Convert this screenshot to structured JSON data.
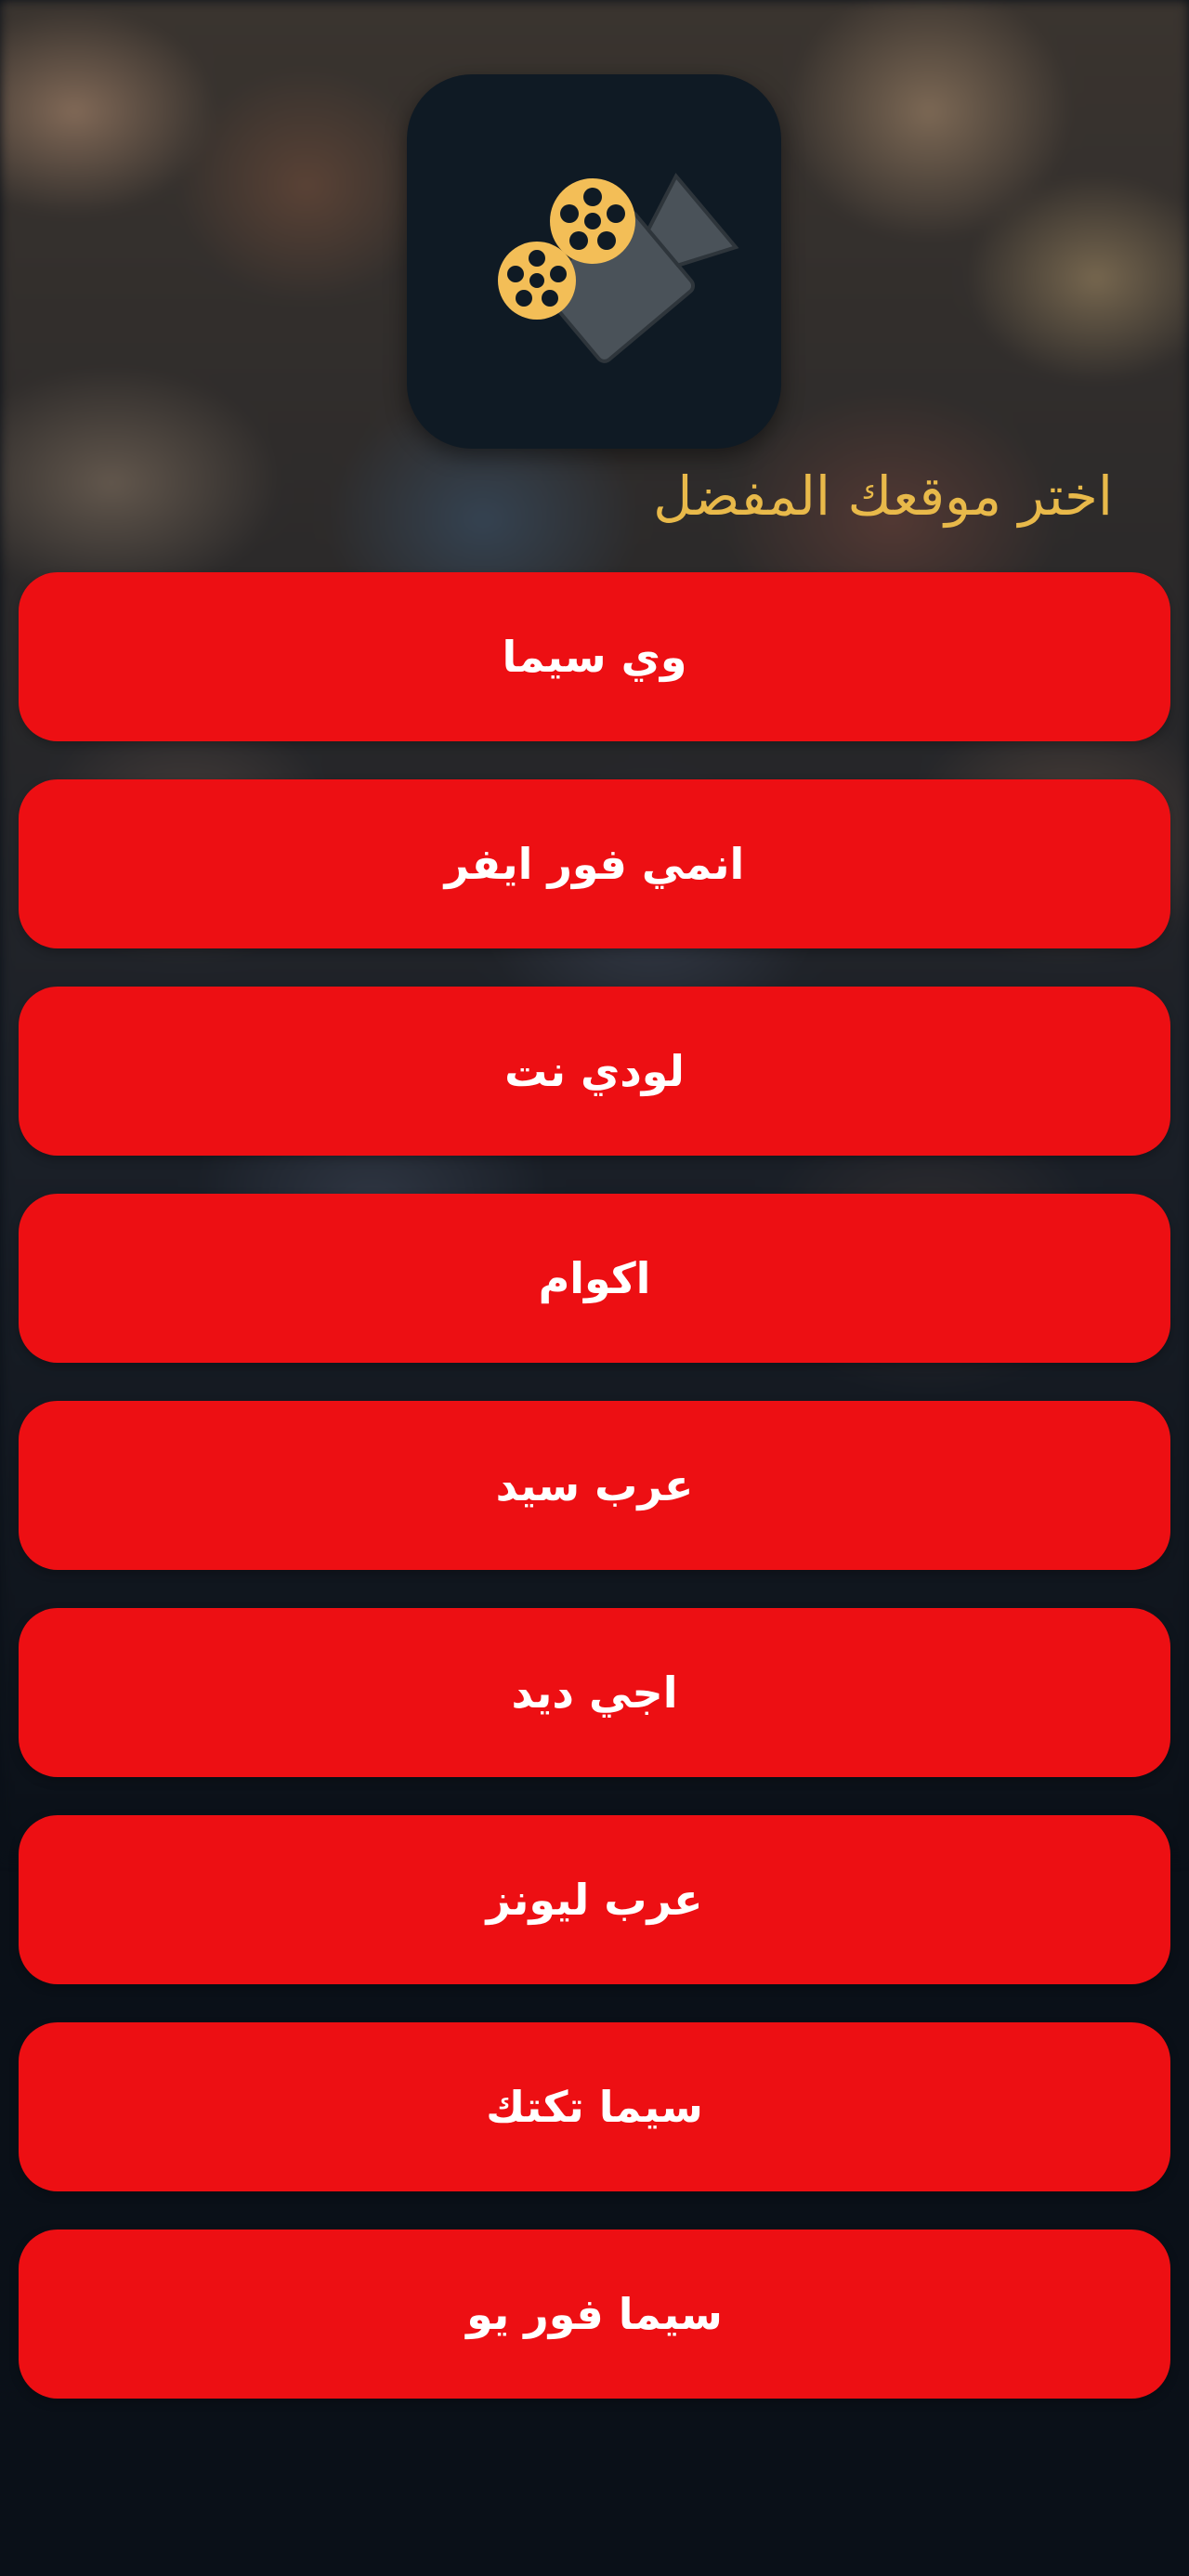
{
  "header": {
    "app_icon": "film-camera-icon",
    "title": "اختر موقعك المفضل"
  },
  "colors": {
    "background": "#0a1018",
    "button": "#ed0f13",
    "button_text": "#ffffff",
    "title": "#e8b94a",
    "icon_background": "#0f1a24",
    "reel": "#f3be57",
    "camera": "#4a5259"
  },
  "sites": [
    {
      "label": "وي سيما"
    },
    {
      "label": "انمي فور ايفر"
    },
    {
      "label": "لودي نت"
    },
    {
      "label": "اكوام"
    },
    {
      "label": "عرب سيد"
    },
    {
      "label": "اجي ديد"
    },
    {
      "label": "عرب ليونز"
    },
    {
      "label": "سيما تكتك"
    },
    {
      "label": "سيما فور يو"
    }
  ]
}
